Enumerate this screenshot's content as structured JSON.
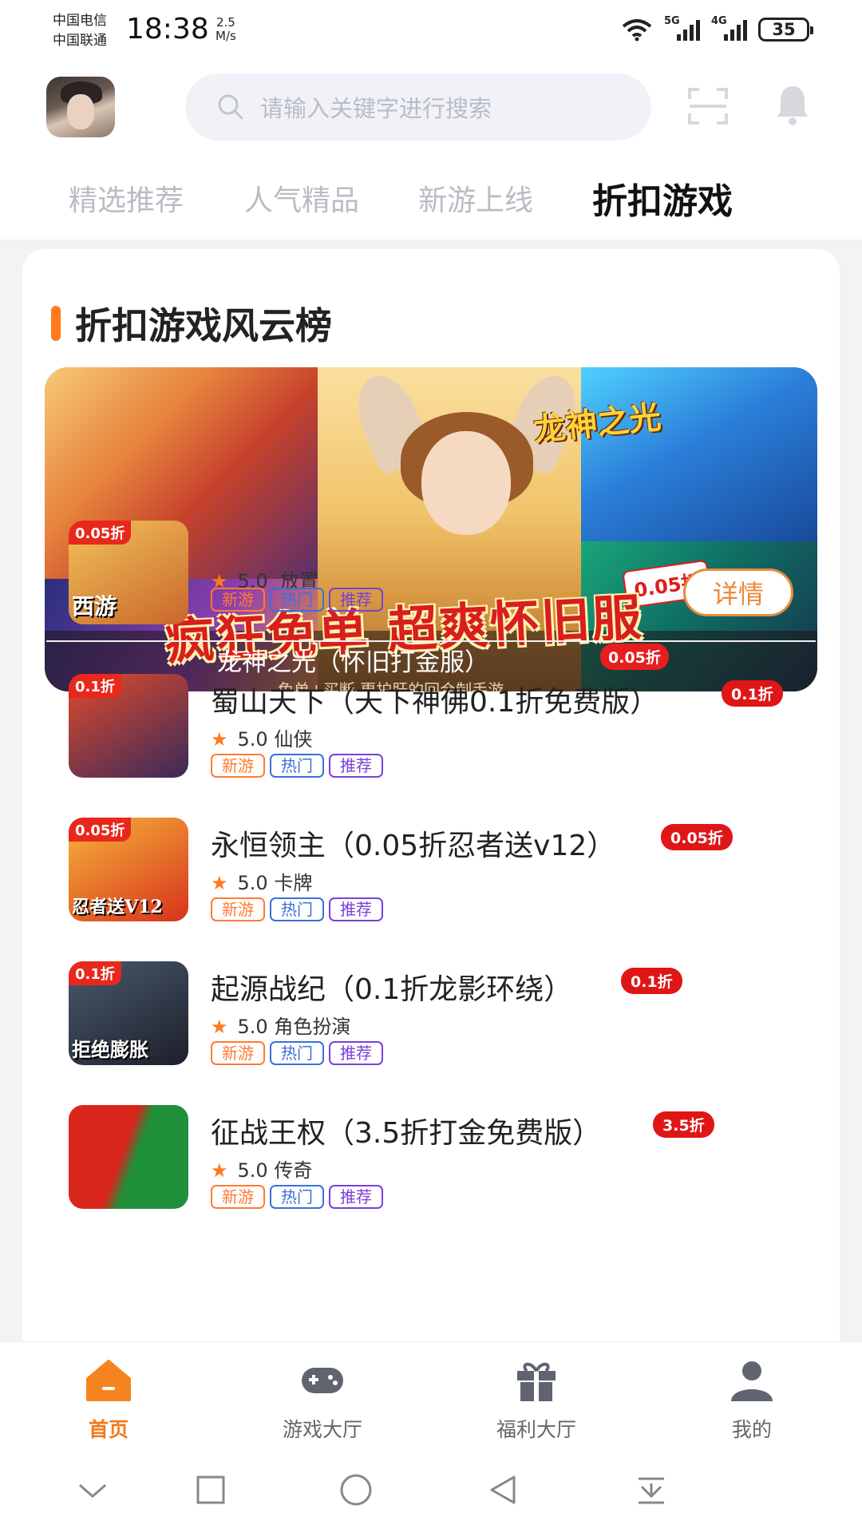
{
  "status_bar": {
    "carrier1": "中国电信",
    "carrier2": "中国联通",
    "time": "18:38",
    "net_speed_value": "2.5",
    "net_speed_unit": "M/s",
    "sig1_tag": "5G",
    "sig2_tag": "4G",
    "battery": "35"
  },
  "header": {
    "search_placeholder": "请输入关键字进行搜索",
    "tabs": [
      {
        "label": "精选推荐",
        "active": false
      },
      {
        "label": "人气精品",
        "active": false
      },
      {
        "label": "新游上线",
        "active": false
      },
      {
        "label": "折扣游戏",
        "active": true
      }
    ]
  },
  "section": {
    "title": "折扣游戏风云榜"
  },
  "banner": {
    "logo_text": "龙神之光",
    "promo_text": "疯狂免单 超爽怀旧服",
    "promo_badge": "0.05折",
    "featured_title": "龙神之光（怀旧打金服）",
    "featured_badge": "0.05折",
    "featured_sub": "免单+买断  更护肝的回合制手游"
  },
  "games": [
    {
      "name": "龙神之光（怀旧打金服）",
      "discount": "0.05折",
      "rating": "5.0",
      "genre": "放置",
      "icon_disc": "0.05折",
      "icon_caption": "西游",
      "colors": [
        "#f2c35a",
        "#c9662b"
      ]
    },
    {
      "name": "蜀山天下（天下神佛0.1折免费版）",
      "discount": "0.1折",
      "rating": "5.0",
      "genre": "仙侠",
      "icon_disc": "0.1折",
      "icon_caption": "",
      "colors": [
        "#e14a2a",
        "#3a2a5a"
      ]
    },
    {
      "name": "永恒领主（0.05折忍者送v12）",
      "discount": "0.05折",
      "rating": "5.0",
      "genre": "卡牌",
      "icon_disc": "0.05折",
      "icon_caption": "忍者送V12",
      "colors": [
        "#f5b53a",
        "#d8321c"
      ]
    },
    {
      "name": "起源战纪（0.1折龙影环绕）",
      "discount": "0.1折",
      "rating": "5.0",
      "genre": "角色扮演",
      "icon_disc": "0.1折",
      "icon_caption": "拒绝膨胀",
      "colors": [
        "#4a5a6e",
        "#1c1f2a"
      ]
    },
    {
      "name": "征战王权（3.5折打金免费版）",
      "discount": "3.5折",
      "rating": "5.0",
      "genre": "传奇",
      "icon_disc": "",
      "icon_caption": "",
      "colors": [
        "#d8261c",
        "#1f8f3a"
      ]
    }
  ],
  "tags": {
    "new": "新游",
    "hot": "热门",
    "rec": "推荐"
  },
  "star": "★",
  "detail_button": "详情",
  "bottom_nav": [
    {
      "label": "首页",
      "icon": "home-icon",
      "active": true
    },
    {
      "label": "游戏大厅",
      "icon": "gamepad-icon",
      "active": false
    },
    {
      "label": "福利大厅",
      "icon": "gift-icon",
      "active": false
    },
    {
      "label": "我的",
      "icon": "user-icon",
      "active": false
    }
  ],
  "colors": {
    "accent": "#f07a1c",
    "discount_red": "#e01616"
  }
}
